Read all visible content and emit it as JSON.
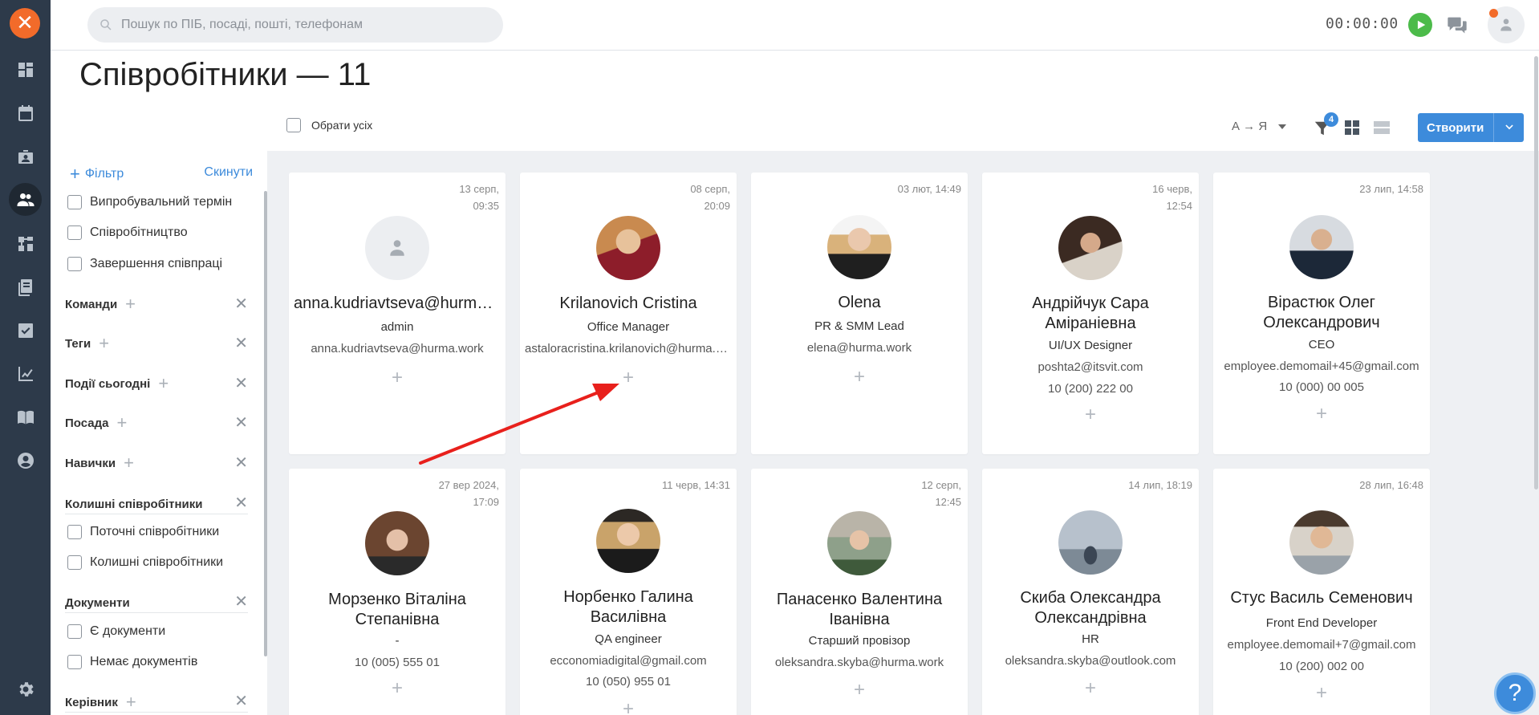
{
  "app": {
    "page_title": "Співробітники — 11",
    "search_placeholder": "Пошук по ПІБ, посаді, пошті, телефонам",
    "timer": "00:00:00",
    "select_all": "Обрати усіх",
    "sort_label": "А → Я",
    "filter_count": "4",
    "create_label": "Створити",
    "help_icon": "?",
    "accent_color": "#3d8bdb",
    "brand_color": "#f26b2a"
  },
  "rail": {
    "icons": [
      "dashboard-icon",
      "calendar-icon",
      "badge-icon",
      "people-icon",
      "structure-icon",
      "documents-icon",
      "tasks-icon",
      "analytics-icon",
      "book-icon",
      "profile-icon",
      "settings-icon"
    ],
    "active": "people-icon"
  },
  "sidebar": {
    "add_filter": "Фільтр",
    "reset": "Скинути",
    "status_options": [
      "Випробувальний термін",
      "Співробітництво",
      "Завершення співпраці"
    ],
    "sections": {
      "teams": "Команди",
      "tags": "Теги",
      "events": "Події сьогодні",
      "position": "Посада",
      "skills": "Навички",
      "former": "Колишні співробітники",
      "documents": "Документи",
      "manager": "Керівник"
    },
    "former_options": [
      "Поточні співробітники",
      "Колишні співробітники"
    ],
    "document_options": [
      "Є документи",
      "Немає документів"
    ]
  },
  "cards": [
    {
      "date": "13 серп, 09:35",
      "date_l1": "13 серп,",
      "date_l2": "09:35",
      "name": "anna.kudriavtseva@hurma.work",
      "position": "admin",
      "email": "anna.kudriavtseva@hurma.work",
      "phone": "",
      "avatar": "placeholder"
    },
    {
      "date": "08 серп, 20:09",
      "date_l1": "08 серп,",
      "date_l2": "20:09",
      "name": "Krilanovich Cristina",
      "position": "Office Manager",
      "email": "astaloracristina.krilanovich@hurma.work",
      "phone": "",
      "avatar": "photo"
    },
    {
      "date": "03 лют, 14:49",
      "date_l1": "03 лют, 14:49",
      "date_l2": "",
      "name": "Olena",
      "position": "PR & SMM Lead",
      "email": "elena@hurma.work",
      "phone": "",
      "avatar": "photo"
    },
    {
      "date": "16 черв, 12:54",
      "date_l1": "16 черв,",
      "date_l2": "12:54",
      "name": "Андрійчук Сара Аміраніевна",
      "position": "UI/UX Designer",
      "email": "poshta2@itsvit.com",
      "phone": "10 (200) 222 00",
      "avatar": "photo"
    },
    {
      "date": "23 лип, 14:58",
      "date_l1": "23 лип, 14:58",
      "date_l2": "",
      "name": "Вірастюк Олег Олександрович",
      "position": "CEO",
      "email": "employee.demomail+45@gmail.com",
      "phone": "10 (000) 00 005",
      "avatar": "photo"
    },
    {
      "date": "27 вер 2024, 17:09",
      "date_l1": "27 вер 2024,",
      "date_l2": "17:09",
      "name": "Морзенко Віталіна Степанівна",
      "position": "-",
      "email": "",
      "phone": "10 (005) 555 01",
      "avatar": "photo"
    },
    {
      "date": "11 черв, 14:31",
      "date_l1": "11 черв, 14:31",
      "date_l2": "",
      "name": "Норбенко Галина Василівна",
      "position": "QA engineer",
      "email": "ecconomiadigital@gmail.com",
      "phone": "10 (050) 955 01",
      "avatar": "photo"
    },
    {
      "date": "12 серп, 12:45",
      "date_l1": "12 серп,",
      "date_l2": "12:45",
      "name": "Панасенко Валентина Іванівна",
      "position": "Старший провізор",
      "email": "oleksandra.skyba@hurma.work",
      "phone": "",
      "avatar": "photo"
    },
    {
      "date": "14 лип, 18:19",
      "date_l1": "14 лип, 18:19",
      "date_l2": "",
      "name": "Скиба Олександра Олександрівна",
      "position": "HR",
      "email": "oleksandra.skyba@outlook.com",
      "phone": "",
      "avatar": "photo"
    },
    {
      "date": "28 лип, 16:48",
      "date_l1": "28 лип, 16:48",
      "date_l2": "",
      "name": "Стус Василь Семенович",
      "position": "Front End Developer",
      "email": "employee.demomail+7@gmail.com",
      "phone": "10 (200) 002 00",
      "avatar": "photo"
    }
  ],
  "plus_glyph": "+"
}
